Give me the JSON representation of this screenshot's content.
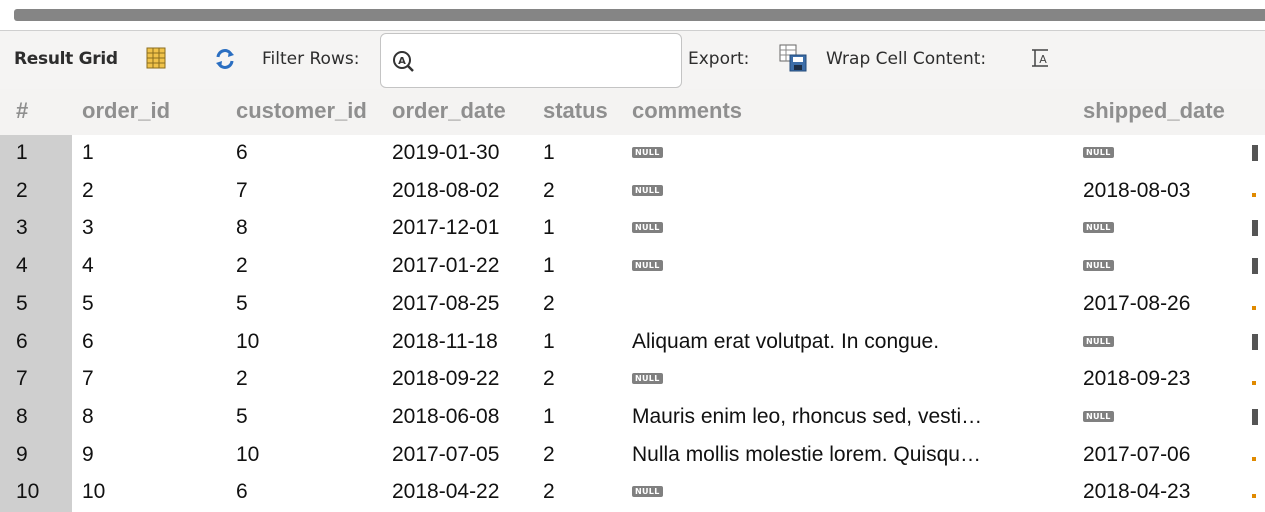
{
  "toolbar": {
    "result_grid_label": "Result Grid",
    "filter_label": "Filter Rows:",
    "filter_value": "",
    "export_label": "Export:",
    "wrap_label": "Wrap Cell Content:"
  },
  "columns": [
    "#",
    "order_id",
    "customer_id",
    "order_date",
    "status",
    "comments",
    "shipped_date"
  ],
  "null_label": "NULL",
  "rows": [
    {
      "num": "1",
      "order_id": "1",
      "customer_id": "6",
      "order_date": "2019-01-30",
      "status": "1",
      "comments": null,
      "shipped_date": null
    },
    {
      "num": "2",
      "order_id": "2",
      "customer_id": "7",
      "order_date": "2018-08-02",
      "status": "2",
      "comments": null,
      "shipped_date": "2018-08-03"
    },
    {
      "num": "3",
      "order_id": "3",
      "customer_id": "8",
      "order_date": "2017-12-01",
      "status": "1",
      "comments": null,
      "shipped_date": null
    },
    {
      "num": "4",
      "order_id": "4",
      "customer_id": "2",
      "order_date": "2017-01-22",
      "status": "1",
      "comments": null,
      "shipped_date": null
    },
    {
      "num": "5",
      "order_id": "5",
      "customer_id": "5",
      "order_date": "2017-08-25",
      "status": "2",
      "comments": "",
      "shipped_date": "2017-08-26"
    },
    {
      "num": "6",
      "order_id": "6",
      "customer_id": "10",
      "order_date": "2018-11-18",
      "status": "1",
      "comments": "Aliquam erat volutpat. In congue.",
      "shipped_date": null
    },
    {
      "num": "7",
      "order_id": "7",
      "customer_id": "2",
      "order_date": "2018-09-22",
      "status": "2",
      "comments": null,
      "shipped_date": "2018-09-23"
    },
    {
      "num": "8",
      "order_id": "8",
      "customer_id": "5",
      "order_date": "2018-06-08",
      "status": "1",
      "comments": "Mauris enim leo, rhoncus sed, vesti…",
      "shipped_date": null
    },
    {
      "num": "9",
      "order_id": "9",
      "customer_id": "10",
      "order_date": "2017-07-05",
      "status": "2",
      "comments": "Nulla mollis molestie lorem. Quisqu…",
      "shipped_date": "2017-07-06"
    },
    {
      "num": "10",
      "order_id": "10",
      "customer_id": "6",
      "order_date": "2018-04-22",
      "status": "2",
      "comments": null,
      "shipped_date": "2018-04-23"
    }
  ],
  "icons": {
    "grid": "result-grid-icon",
    "refresh": "refresh-icon",
    "filter": "filter-search-icon",
    "export": "export-icon",
    "wrap": "wrap-cell-icon"
  },
  "colors": {
    "header_text": "#8f8f8f",
    "rownum_bg": "#cfcfcf",
    "null_badge": "#808080",
    "toolbar_bg": "#f5f4f3"
  }
}
